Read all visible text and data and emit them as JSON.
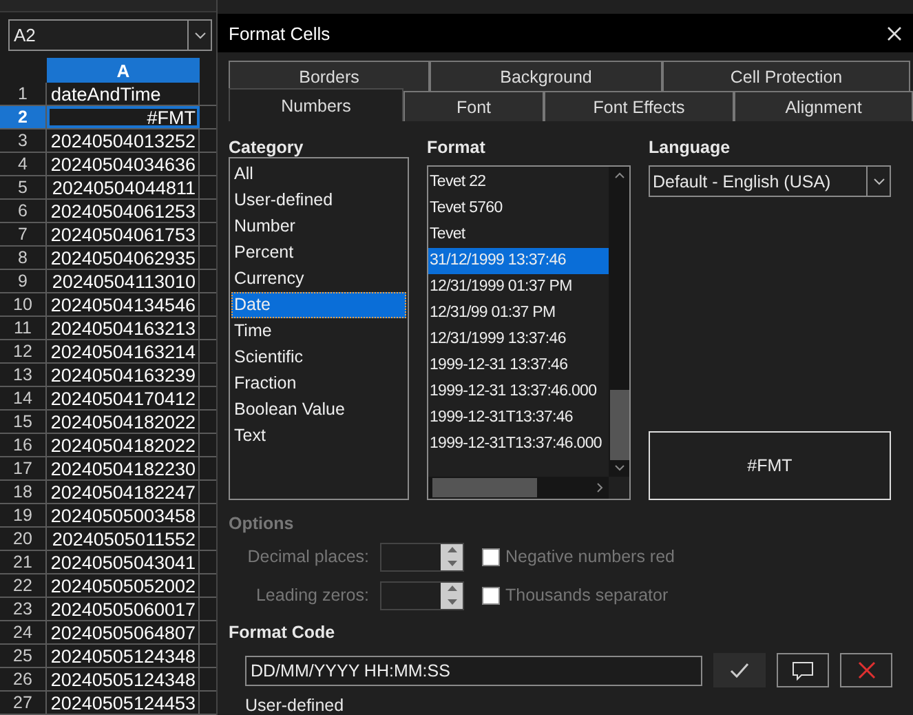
{
  "name_box": {
    "value": "A2"
  },
  "sheet": {
    "column": "A",
    "rows": [
      {
        "number": "1",
        "value": "dateAndTime",
        "kind": "text",
        "selected": false
      },
      {
        "number": "2",
        "value": "#FMT",
        "kind": "number",
        "selected": true
      },
      {
        "number": "3",
        "value": "20240504013252",
        "kind": "number",
        "selected": false
      },
      {
        "number": "4",
        "value": "20240504034636",
        "kind": "number",
        "selected": false
      },
      {
        "number": "5",
        "value": "20240504044811",
        "kind": "number",
        "selected": false
      },
      {
        "number": "6",
        "value": "20240504061253",
        "kind": "number",
        "selected": false
      },
      {
        "number": "7",
        "value": "20240504061753",
        "kind": "number",
        "selected": false
      },
      {
        "number": "8",
        "value": "20240504062935",
        "kind": "number",
        "selected": false
      },
      {
        "number": "9",
        "value": "20240504113010",
        "kind": "number",
        "selected": false
      },
      {
        "number": "10",
        "value": "20240504134546",
        "kind": "number",
        "selected": false
      },
      {
        "number": "11",
        "value": "20240504163213",
        "kind": "number",
        "selected": false
      },
      {
        "number": "12",
        "value": "20240504163214",
        "kind": "number",
        "selected": false
      },
      {
        "number": "13",
        "value": "20240504163239",
        "kind": "number",
        "selected": false
      },
      {
        "number": "14",
        "value": "20240504170412",
        "kind": "number",
        "selected": false
      },
      {
        "number": "15",
        "value": "20240504182022",
        "kind": "number",
        "selected": false
      },
      {
        "number": "16",
        "value": "20240504182022",
        "kind": "number",
        "selected": false
      },
      {
        "number": "17",
        "value": "20240504182230",
        "kind": "number",
        "selected": false
      },
      {
        "number": "18",
        "value": "20240504182247",
        "kind": "number",
        "selected": false
      },
      {
        "number": "19",
        "value": "20240505003458",
        "kind": "number",
        "selected": false
      },
      {
        "number": "20",
        "value": "20240505011552",
        "kind": "number",
        "selected": false
      },
      {
        "number": "21",
        "value": "20240505043041",
        "kind": "number",
        "selected": false
      },
      {
        "number": "22",
        "value": "20240505052002",
        "kind": "number",
        "selected": false
      },
      {
        "number": "23",
        "value": "20240505060017",
        "kind": "number",
        "selected": false
      },
      {
        "number": "24",
        "value": "20240505064807",
        "kind": "number",
        "selected": false
      },
      {
        "number": "25",
        "value": "20240505124348",
        "kind": "number",
        "selected": false
      },
      {
        "number": "26",
        "value": "20240505124348",
        "kind": "number",
        "selected": false
      },
      {
        "number": "27",
        "value": "20240505124453",
        "kind": "number",
        "selected": false
      }
    ]
  },
  "dialog": {
    "title": "Format Cells",
    "tabs_back": [
      {
        "label": "Borders",
        "selected": false
      },
      {
        "label": "Background",
        "selected": false
      },
      {
        "label": "Cell Protection",
        "selected": false
      }
    ],
    "tabs_front": [
      {
        "label": "Numbers",
        "selected": true
      },
      {
        "label": "Font",
        "selected": false
      },
      {
        "label": "Font Effects",
        "selected": false
      },
      {
        "label": "Alignment",
        "selected": false
      }
    ],
    "category": {
      "label": "Category",
      "items": [
        {
          "label": "All",
          "selected": false
        },
        {
          "label": "User-defined",
          "selected": false
        },
        {
          "label": "Number",
          "selected": false
        },
        {
          "label": "Percent",
          "selected": false
        },
        {
          "label": "Currency",
          "selected": false
        },
        {
          "label": "Date",
          "selected": true
        },
        {
          "label": "Time",
          "selected": false
        },
        {
          "label": "Scientific",
          "selected": false
        },
        {
          "label": "Fraction",
          "selected": false
        },
        {
          "label": "Boolean Value",
          "selected": false
        },
        {
          "label": "Text",
          "selected": false
        }
      ]
    },
    "format": {
      "label": "Format",
      "items": [
        {
          "label": "Tevet 22",
          "selected": false
        },
        {
          "label": "Tevet 5760",
          "selected": false
        },
        {
          "label": "Tevet",
          "selected": false
        },
        {
          "label": "31/12/1999 13:37:46",
          "selected": true
        },
        {
          "label": "12/31/1999 01:37 PM",
          "selected": false
        },
        {
          "label": "12/31/99 01:37 PM",
          "selected": false
        },
        {
          "label": "12/31/1999 13:37:46",
          "selected": false
        },
        {
          "label": "1999-12-31 13:37:46",
          "selected": false
        },
        {
          "label": "1999-12-31 13:37:46.000",
          "selected": false
        },
        {
          "label": "1999-12-31T13:37:46",
          "selected": false
        },
        {
          "label": "1999-12-31T13:37:46.000",
          "selected": false
        }
      ]
    },
    "language": {
      "label": "Language",
      "value": "Default - English (USA)"
    },
    "preview": "#FMT",
    "options": {
      "label": "Options",
      "disabled": true,
      "decimal_places": "Decimal places:",
      "leading_zeros": "Leading zeros:",
      "checks": [
        {
          "label": "Negative numbers red",
          "checked": false
        },
        {
          "label": "Thousands separator",
          "checked": false
        }
      ]
    },
    "format_code": {
      "label": "Format Code",
      "value": "DD/MM/YYYY HH:MM:SS"
    },
    "description": "User-defined"
  }
}
